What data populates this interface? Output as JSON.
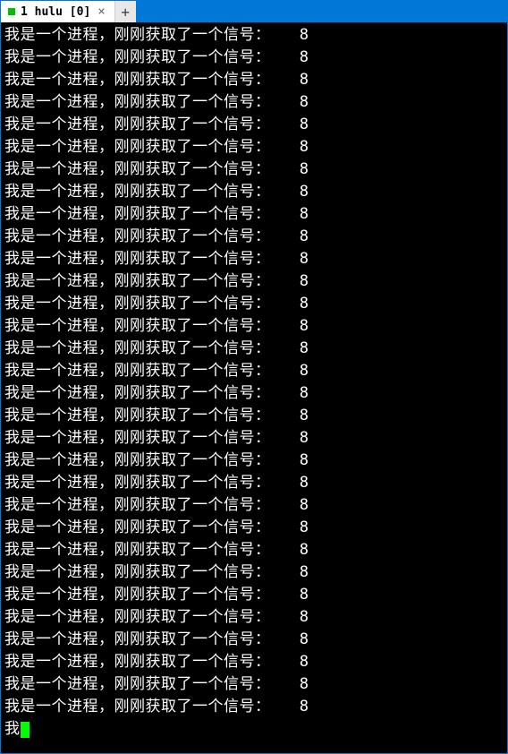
{
  "tab": {
    "title": "1 hulu [0]",
    "close_label": "×",
    "new_tab_label": "+"
  },
  "terminal": {
    "message_text": "我是一个进程，刚刚获取了一个信号：   ",
    "value_text": "8",
    "line_count": 31,
    "partial_text": "我"
  }
}
